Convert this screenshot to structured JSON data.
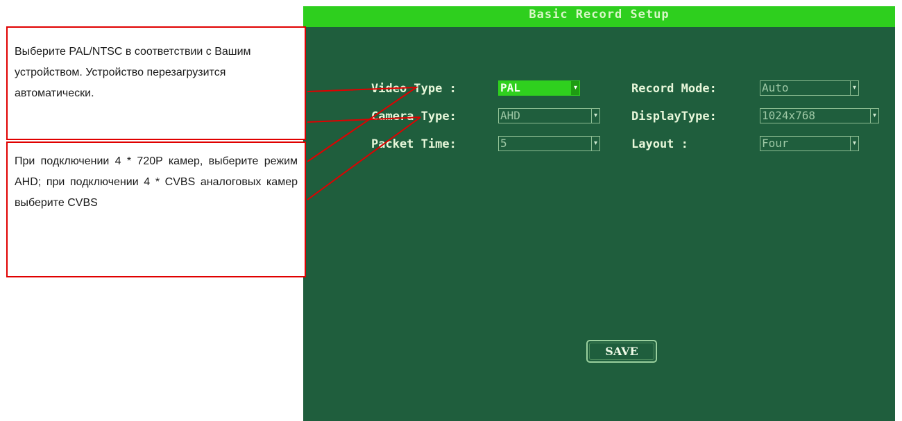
{
  "window": {
    "title": "Basic Record Setup"
  },
  "fields": {
    "video_type": {
      "label": "Video Type :",
      "value": "PAL"
    },
    "camera_type": {
      "label": "Camera Type:",
      "value": "AHD"
    },
    "packet_time": {
      "label": "Packet Time:",
      "value": "5"
    },
    "record_mode": {
      "label": "Record Mode:",
      "value": "Auto"
    },
    "display_type": {
      "label": "DisplayType:",
      "value": "1024x768"
    },
    "layout": {
      "label": "Layout :",
      "value": "Four"
    }
  },
  "save_label": "SAVE",
  "callouts": {
    "video_type_note": "Выберите PAL/NTSC в соответствии с Вашим устройством. Устройство перезагрузится автоматически.",
    "camera_type_note": "При подключении 4 * 720P камер, выберите режим AHD; при подключении 4 * CVBS аналоговых камер выберите CVBS"
  },
  "colors": {
    "screen_bg": "#1f5e3d",
    "title_bar": "#2ecf1e",
    "callout_border": "#e00000"
  }
}
